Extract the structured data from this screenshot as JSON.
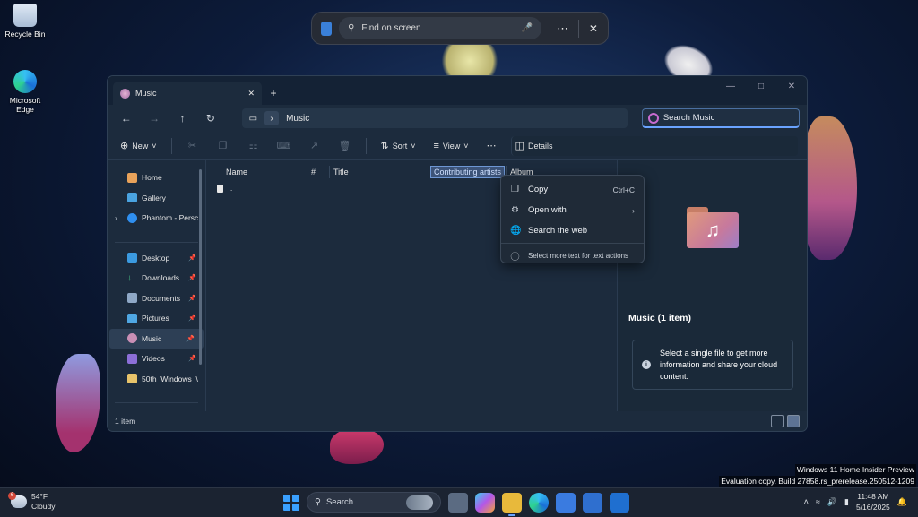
{
  "desktop": {
    "icons": [
      {
        "label": "Recycle Bin"
      },
      {
        "label": "Microsoft Edge"
      }
    ]
  },
  "findbar": {
    "placeholder": "Find on screen",
    "icons": [
      "app-icon",
      "search-icon",
      "microphone-icon",
      "more-icon",
      "close-icon"
    ]
  },
  "window": {
    "tab_title": "Music",
    "address": {
      "location": "Music"
    },
    "search": {
      "placeholder": "Search Music"
    },
    "commands": {
      "new_label": "New",
      "sort_label": "Sort",
      "view_label": "View",
      "details_label": "Details"
    },
    "nav": {
      "items": [
        {
          "label": "Home"
        },
        {
          "label": "Gallery"
        },
        {
          "label": "Phantom - Persc"
        },
        {
          "label": "Desktop"
        },
        {
          "label": "Downloads"
        },
        {
          "label": "Documents"
        },
        {
          "label": "Pictures"
        },
        {
          "label": "Music"
        },
        {
          "label": "Videos"
        },
        {
          "label": "50th_Windows_\\"
        }
      ]
    },
    "columns": {
      "name": "Name",
      "number": "#",
      "title": "Title",
      "contributing": "Contributing artists",
      "album": "Album"
    },
    "file": {
      "name": "."
    },
    "details_pane": {
      "title": "Music (1 item)",
      "message": "Select a single file to get more information and share your cloud content."
    },
    "status": {
      "item_count": "1 item"
    }
  },
  "context_menu": {
    "items": [
      {
        "label": "Copy",
        "shortcut": "Ctrl+C"
      },
      {
        "label": "Open with"
      },
      {
        "label": "Search the web"
      },
      {
        "label": "Select more text for text actions"
      }
    ]
  },
  "watermark": {
    "line1": "Windows 11 Home Insider Preview",
    "line2": "Evaluation copy. Build 27858.rs_prerelease.250512-1209"
  },
  "taskbar": {
    "weather": {
      "temp": "54°F",
      "condition": "Cloudy",
      "badge": "6"
    },
    "search_placeholder": "Search",
    "clock": {
      "time": "11:48 AM",
      "date": "5/16/2025"
    }
  },
  "colors": {
    "accent": "#6aa3ff",
    "window_bg": "#1c2b3d",
    "highlight": "#3c5378"
  }
}
